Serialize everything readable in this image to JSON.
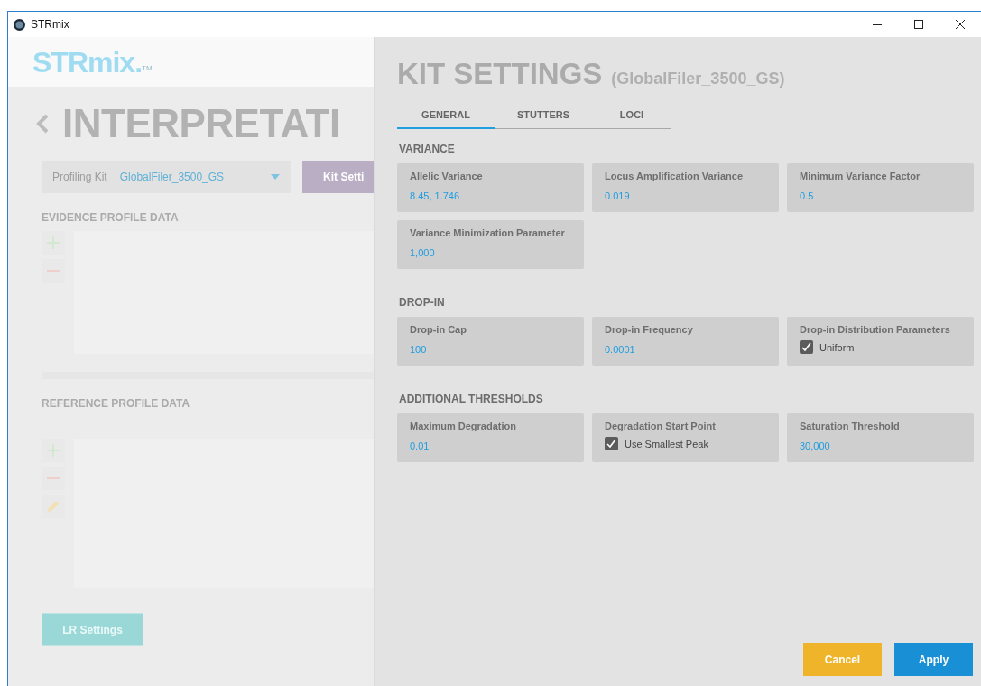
{
  "window": {
    "title": "STRmix"
  },
  "background": {
    "logo": "STRmix.",
    "logo_mark": "TM",
    "title": "INTERPRETATI",
    "profiling_kit": {
      "label": "Profiling Kit",
      "value": "GlobalFiler_3500_GS"
    },
    "kit_button": "Kit Setti",
    "evidence_heading": "EVIDENCE PROFILE DATA",
    "reference_heading": "REFERENCE PROFILE DATA",
    "lr_button": "LR Settings"
  },
  "panel": {
    "title": "KIT SETTINGS",
    "subtitle": "(GlobalFiler_3500_GS)",
    "tabs": [
      {
        "label": "GENERAL",
        "selected": true
      },
      {
        "label": "STUTTERS",
        "selected": false
      },
      {
        "label": "LOCI",
        "selected": false
      }
    ],
    "sections": [
      {
        "heading": "VARIANCE",
        "fields": [
          {
            "label": "Allelic Variance",
            "kind": "value",
            "value": "8.45, 1.746"
          },
          {
            "label": "Locus Amplification Variance",
            "kind": "value",
            "value": "0.019"
          },
          {
            "label": "Minimum Variance Factor",
            "kind": "value",
            "value": "0.5"
          },
          {
            "label": "Variance Minimization Parameter",
            "kind": "value",
            "value": "1,000"
          }
        ]
      },
      {
        "heading": "DROP-IN",
        "fields": [
          {
            "label": "Drop-in Cap",
            "kind": "value",
            "value": "100"
          },
          {
            "label": "Drop-in Frequency",
            "kind": "value",
            "value": "0.0001"
          },
          {
            "label": "Drop-in Distribution Parameters",
            "kind": "checkbox",
            "value": "Uniform",
            "checked": true
          }
        ]
      },
      {
        "heading": "ADDITIONAL THRESHOLDS",
        "fields": [
          {
            "label": "Maximum Degradation",
            "kind": "value",
            "value": "0.01"
          },
          {
            "label": "Degradation Start Point",
            "kind": "checkbox",
            "value": "Use Smallest Peak",
            "checked": true
          },
          {
            "label": "Saturation Threshold",
            "kind": "value",
            "value": "30,000"
          }
        ]
      }
    ],
    "buttons": [
      {
        "label": "Cancel",
        "kind": "secondary"
      },
      {
        "label": "Apply",
        "kind": "primary"
      }
    ]
  }
}
